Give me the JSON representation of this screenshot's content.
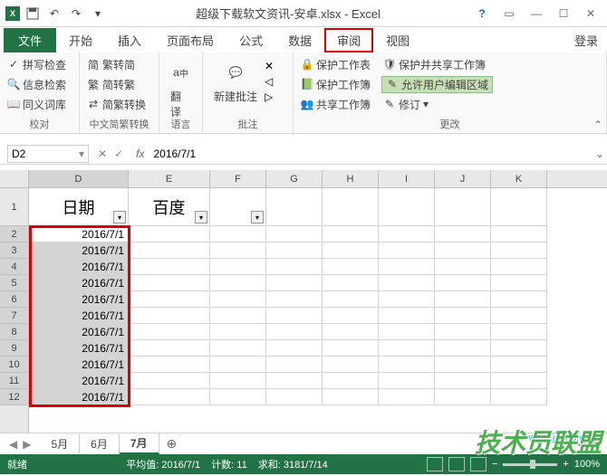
{
  "titlebar": {
    "title": "超级下载软文资讯-安卓.xlsx - Excel"
  },
  "menu": {
    "file": "文件",
    "tabs": [
      "开始",
      "插入",
      "页面布局",
      "公式",
      "数据",
      "审阅",
      "视图"
    ],
    "active_index": 5,
    "login": "登录"
  },
  "ribbon": {
    "proofing": {
      "spell": "拼写检查",
      "research": "信息检索",
      "thesaurus": "同义词库",
      "label": "校对"
    },
    "chinese": {
      "simp_trad": "繁转简",
      "trad_simp": "简转繁",
      "convert": "简繁转换",
      "label": "中文简繁转换"
    },
    "language": {
      "translate": "翻译",
      "label": "语言"
    },
    "comments": {
      "new": "新建批注",
      "label": "批注"
    },
    "changes": {
      "protect_sheet": "保护工作表",
      "protect_book": "保护工作簿",
      "share_book": "共享工作簿",
      "protect_share": "保护并共享工作簿",
      "allow_edit": "允许用户编辑区域",
      "track": "修订",
      "label": "更改"
    }
  },
  "formula_bar": {
    "name_box": "D2",
    "formula": "2016/7/1"
  },
  "columns": [
    "D",
    "E",
    "F",
    "G",
    "H",
    "I",
    "J",
    "K"
  ],
  "headers": {
    "d": "日期",
    "e": "百度"
  },
  "rows": [
    {
      "n": 1
    },
    {
      "n": 2,
      "d": "2016/7/1"
    },
    {
      "n": 3,
      "d": "2016/7/1"
    },
    {
      "n": 4,
      "d": "2016/7/1"
    },
    {
      "n": 5,
      "d": "2016/7/1"
    },
    {
      "n": 6,
      "d": "2016/7/1"
    },
    {
      "n": 7,
      "d": "2016/7/1"
    },
    {
      "n": 8,
      "d": "2016/7/1"
    },
    {
      "n": 9,
      "d": "2016/7/1"
    },
    {
      "n": 10,
      "d": "2016/7/1"
    },
    {
      "n": 11,
      "d": "2016/7/1"
    },
    {
      "n": 12,
      "d": "2016/7/1"
    }
  ],
  "sheets": {
    "tabs": [
      "5月",
      "6月",
      "7月"
    ],
    "active_index": 2
  },
  "status": {
    "ready": "就绪",
    "avg_label": "平均值:",
    "avg": "2016/7/1",
    "count_label": "计数:",
    "count": "11",
    "sum_label": "求和:",
    "sum": "3181/7/14",
    "zoom": "100%"
  },
  "watermark": {
    "text": "技术员联盟",
    "url": "www.jsgho.com"
  }
}
